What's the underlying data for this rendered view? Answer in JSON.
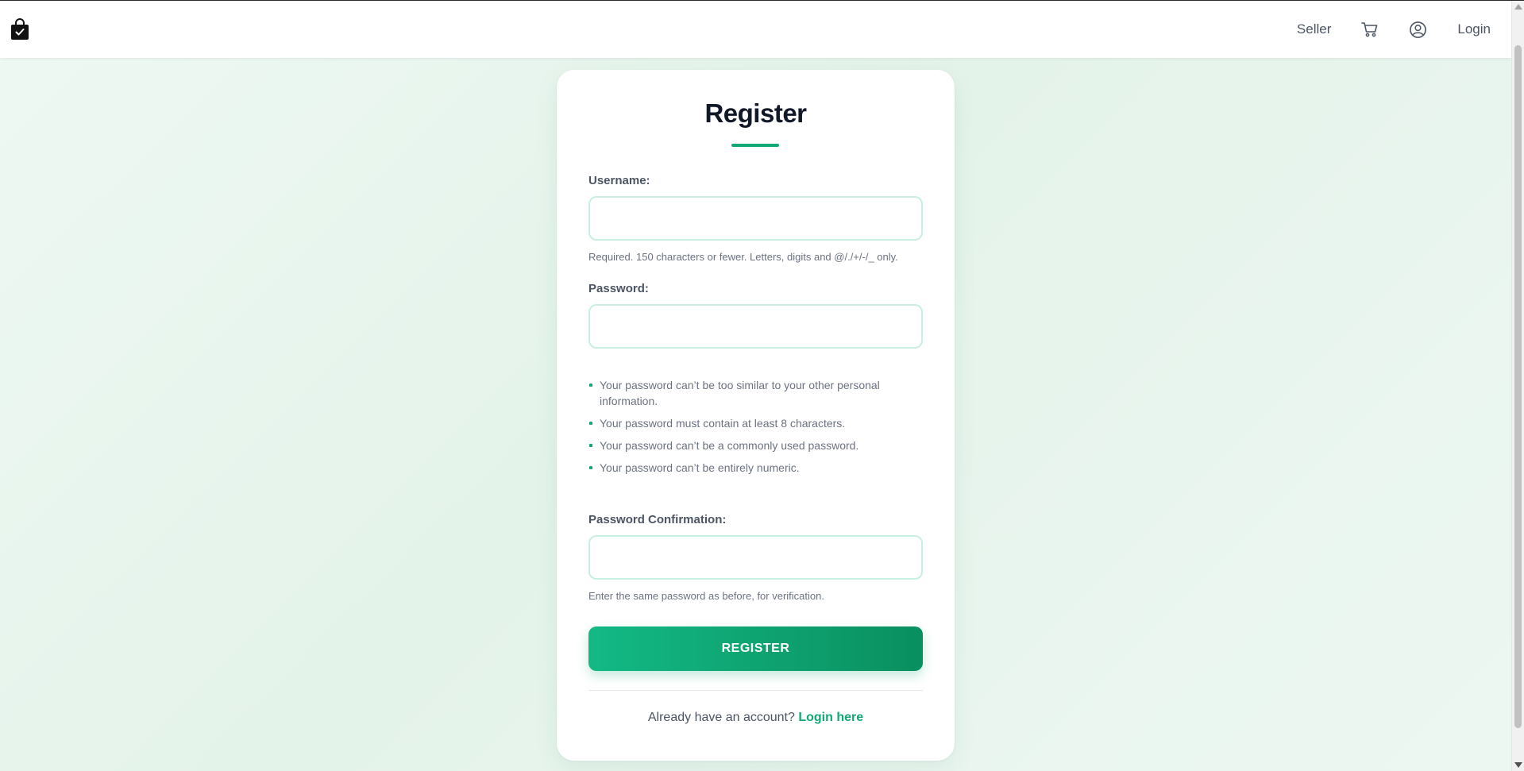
{
  "nav": {
    "brand_icon": "shopping-bag-check-icon",
    "seller_label": "Seller",
    "cart_icon": "cart-icon",
    "account_icon": "user-circle-icon",
    "login_label": "Login"
  },
  "form": {
    "title": "Register",
    "username": {
      "label": "Username:",
      "value": "",
      "help": "Required. 150 characters or fewer. Letters, digits and @/./+/-/_ only."
    },
    "password": {
      "label": "Password:",
      "value": "",
      "rules": [
        "Your password can’t be too similar to your other personal information.",
        "Your password must contain at least 8 characters.",
        "Your password can’t be a commonly used password.",
        "Your password can’t be entirely numeric."
      ]
    },
    "password_confirmation": {
      "label": "Password Confirmation:",
      "value": "",
      "help": "Enter the same password as before, for verification."
    },
    "submit_label": "REGISTER",
    "footer_text": "Already have an account?",
    "footer_link": "Login here"
  },
  "colors": {
    "accent": "#10a874",
    "accent_dark": "#0a8f5f",
    "input_border": "#c8efe0",
    "background": "#e8f5ee"
  }
}
